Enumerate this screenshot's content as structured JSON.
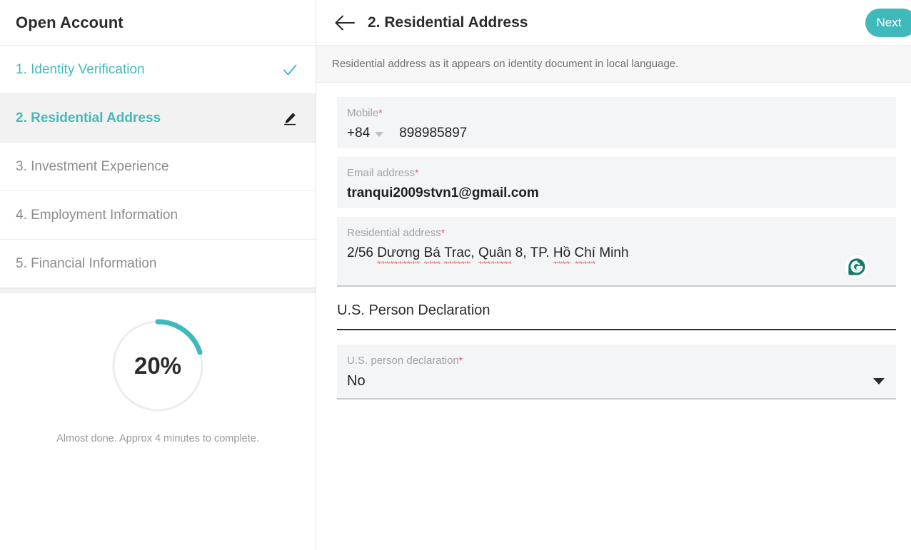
{
  "sidebar": {
    "title": "Open Account",
    "steps": [
      {
        "label": "1. Identity Verification",
        "state": "done",
        "icon": "check-icon"
      },
      {
        "label": "2. Residential Address",
        "state": "active",
        "icon": "pencil-icon"
      },
      {
        "label": "3. Investment Experience",
        "state": "pending",
        "icon": ""
      },
      {
        "label": "4. Employment Information",
        "state": "pending",
        "icon": ""
      },
      {
        "label": "5. Financial Information",
        "state": "pending",
        "icon": ""
      }
    ],
    "progress": {
      "percent_label": "20%",
      "percent_value": 20,
      "note": "Almost done. Approx 4 minutes to complete.",
      "arc_color": "#40b9bd",
      "track_color": "#ededed"
    }
  },
  "header": {
    "back_icon": "arrow-left-icon",
    "title": "2. Residential Address",
    "next_label": "Next",
    "next_color": "#40b9bd"
  },
  "subtitle": "Residential address as it appears on identity document in local language.",
  "form": {
    "mobile": {
      "label": "Mobile",
      "required_marker": "*",
      "country_code": "+84",
      "number": "898985897"
    },
    "email": {
      "label": "Email address",
      "required_marker": "*",
      "value": "tranqui2009stvn1@gmail.com"
    },
    "address": {
      "label": "Residential address",
      "required_marker": "*",
      "value_parts": [
        {
          "text": "2/56 ",
          "spellcheck_error": false
        },
        {
          "text": "Dương",
          "spellcheck_error": true
        },
        {
          "text": " ",
          "spellcheck_error": false
        },
        {
          "text": "Bá",
          "spellcheck_error": true
        },
        {
          "text": " ",
          "spellcheck_error": false
        },
        {
          "text": "Trac",
          "spellcheck_error": true
        },
        {
          "text": ", ",
          "spellcheck_error": false
        },
        {
          "text": "Quân",
          "spellcheck_error": true
        },
        {
          "text": " 8, TP. ",
          "spellcheck_error": false
        },
        {
          "text": "Hồ",
          "spellcheck_error": true
        },
        {
          "text": " ",
          "spellcheck_error": false
        },
        {
          "text": "Chí",
          "spellcheck_error": true
        },
        {
          "text": " Minh",
          "spellcheck_error": false
        }
      ],
      "value": "2/56 Dương Bá Trac, Quân 8, TP. Hồ Chí Minh",
      "assistant_icon": "grammarly-icon"
    },
    "section_title": "U.S. Person Declaration",
    "us_person": {
      "label": "U.S. person declaration",
      "required_marker": "*",
      "value": "No",
      "caret_icon": "chevron-down-icon"
    }
  }
}
